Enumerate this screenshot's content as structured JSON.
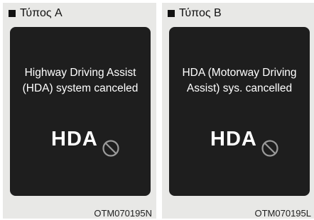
{
  "panels": [
    {
      "title": "Τύπος A",
      "message_line1": "Highway Driving Assist",
      "message_line2": "(HDA) system canceled",
      "symbol": "HDA",
      "code": "OTM070195N"
    },
    {
      "title": "Τύπος B",
      "message_line1": "HDA (Motorway Driving",
      "message_line2": "Assist) sys. cancelled",
      "symbol": "HDA",
      "code": "OTM070195L"
    }
  ],
  "icons": {
    "cancel": "prohibited-icon"
  },
  "colors": {
    "panel_bg": "#e8e8e6",
    "screen_bg": "#1e1e1e",
    "text": "#ffffff"
  }
}
